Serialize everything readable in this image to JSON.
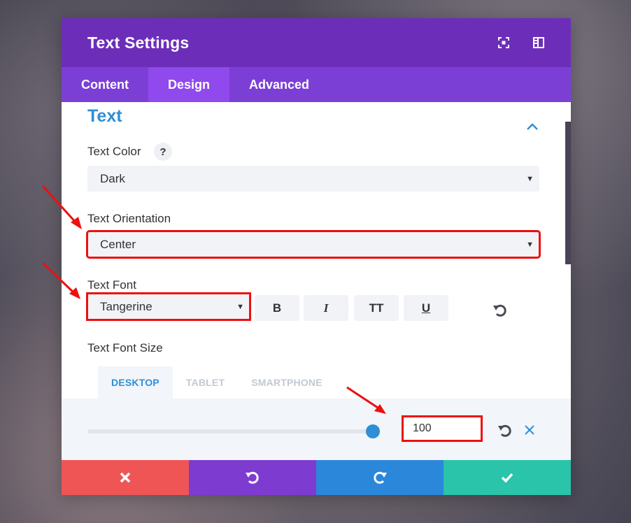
{
  "modal": {
    "title": "Text Settings",
    "header_icons": [
      "expand-icon",
      "sidebar-icon"
    ]
  },
  "tabs": [
    {
      "label": "Content",
      "active": false
    },
    {
      "label": "Design",
      "active": true
    },
    {
      "label": "Advanced",
      "active": false
    }
  ],
  "section": {
    "title": "Text"
  },
  "text_color": {
    "label": "Text Color",
    "help": "?",
    "value": "Dark"
  },
  "text_orientation": {
    "label": "Text Orientation",
    "value": "Center"
  },
  "text_font": {
    "label": "Text Font",
    "value": "Tangerine",
    "buttons": {
      "bold": "B",
      "italic": "I",
      "uppercase": "TT",
      "underline": "U"
    }
  },
  "text_font_size": {
    "label": "Text Font Size",
    "device_tabs": [
      "DESKTOP",
      "TABLET",
      "SMARTPHONE"
    ],
    "active_device": "DESKTOP",
    "value": "100",
    "slider_level": 1.0
  },
  "footer": {
    "buttons": [
      "close-icon",
      "undo-icon",
      "redo-icon",
      "check-icon"
    ]
  },
  "colors": {
    "header": "#6c2eb9",
    "tabs": "#7b3fd6",
    "active_tab": "#8f49ec",
    "accent": "#2e8fd6",
    "highlight": "#ee0f0f",
    "cancel": "#ef5555",
    "undo": "#7e3bd0",
    "redo": "#2b87da",
    "save": "#29c4a9"
  }
}
